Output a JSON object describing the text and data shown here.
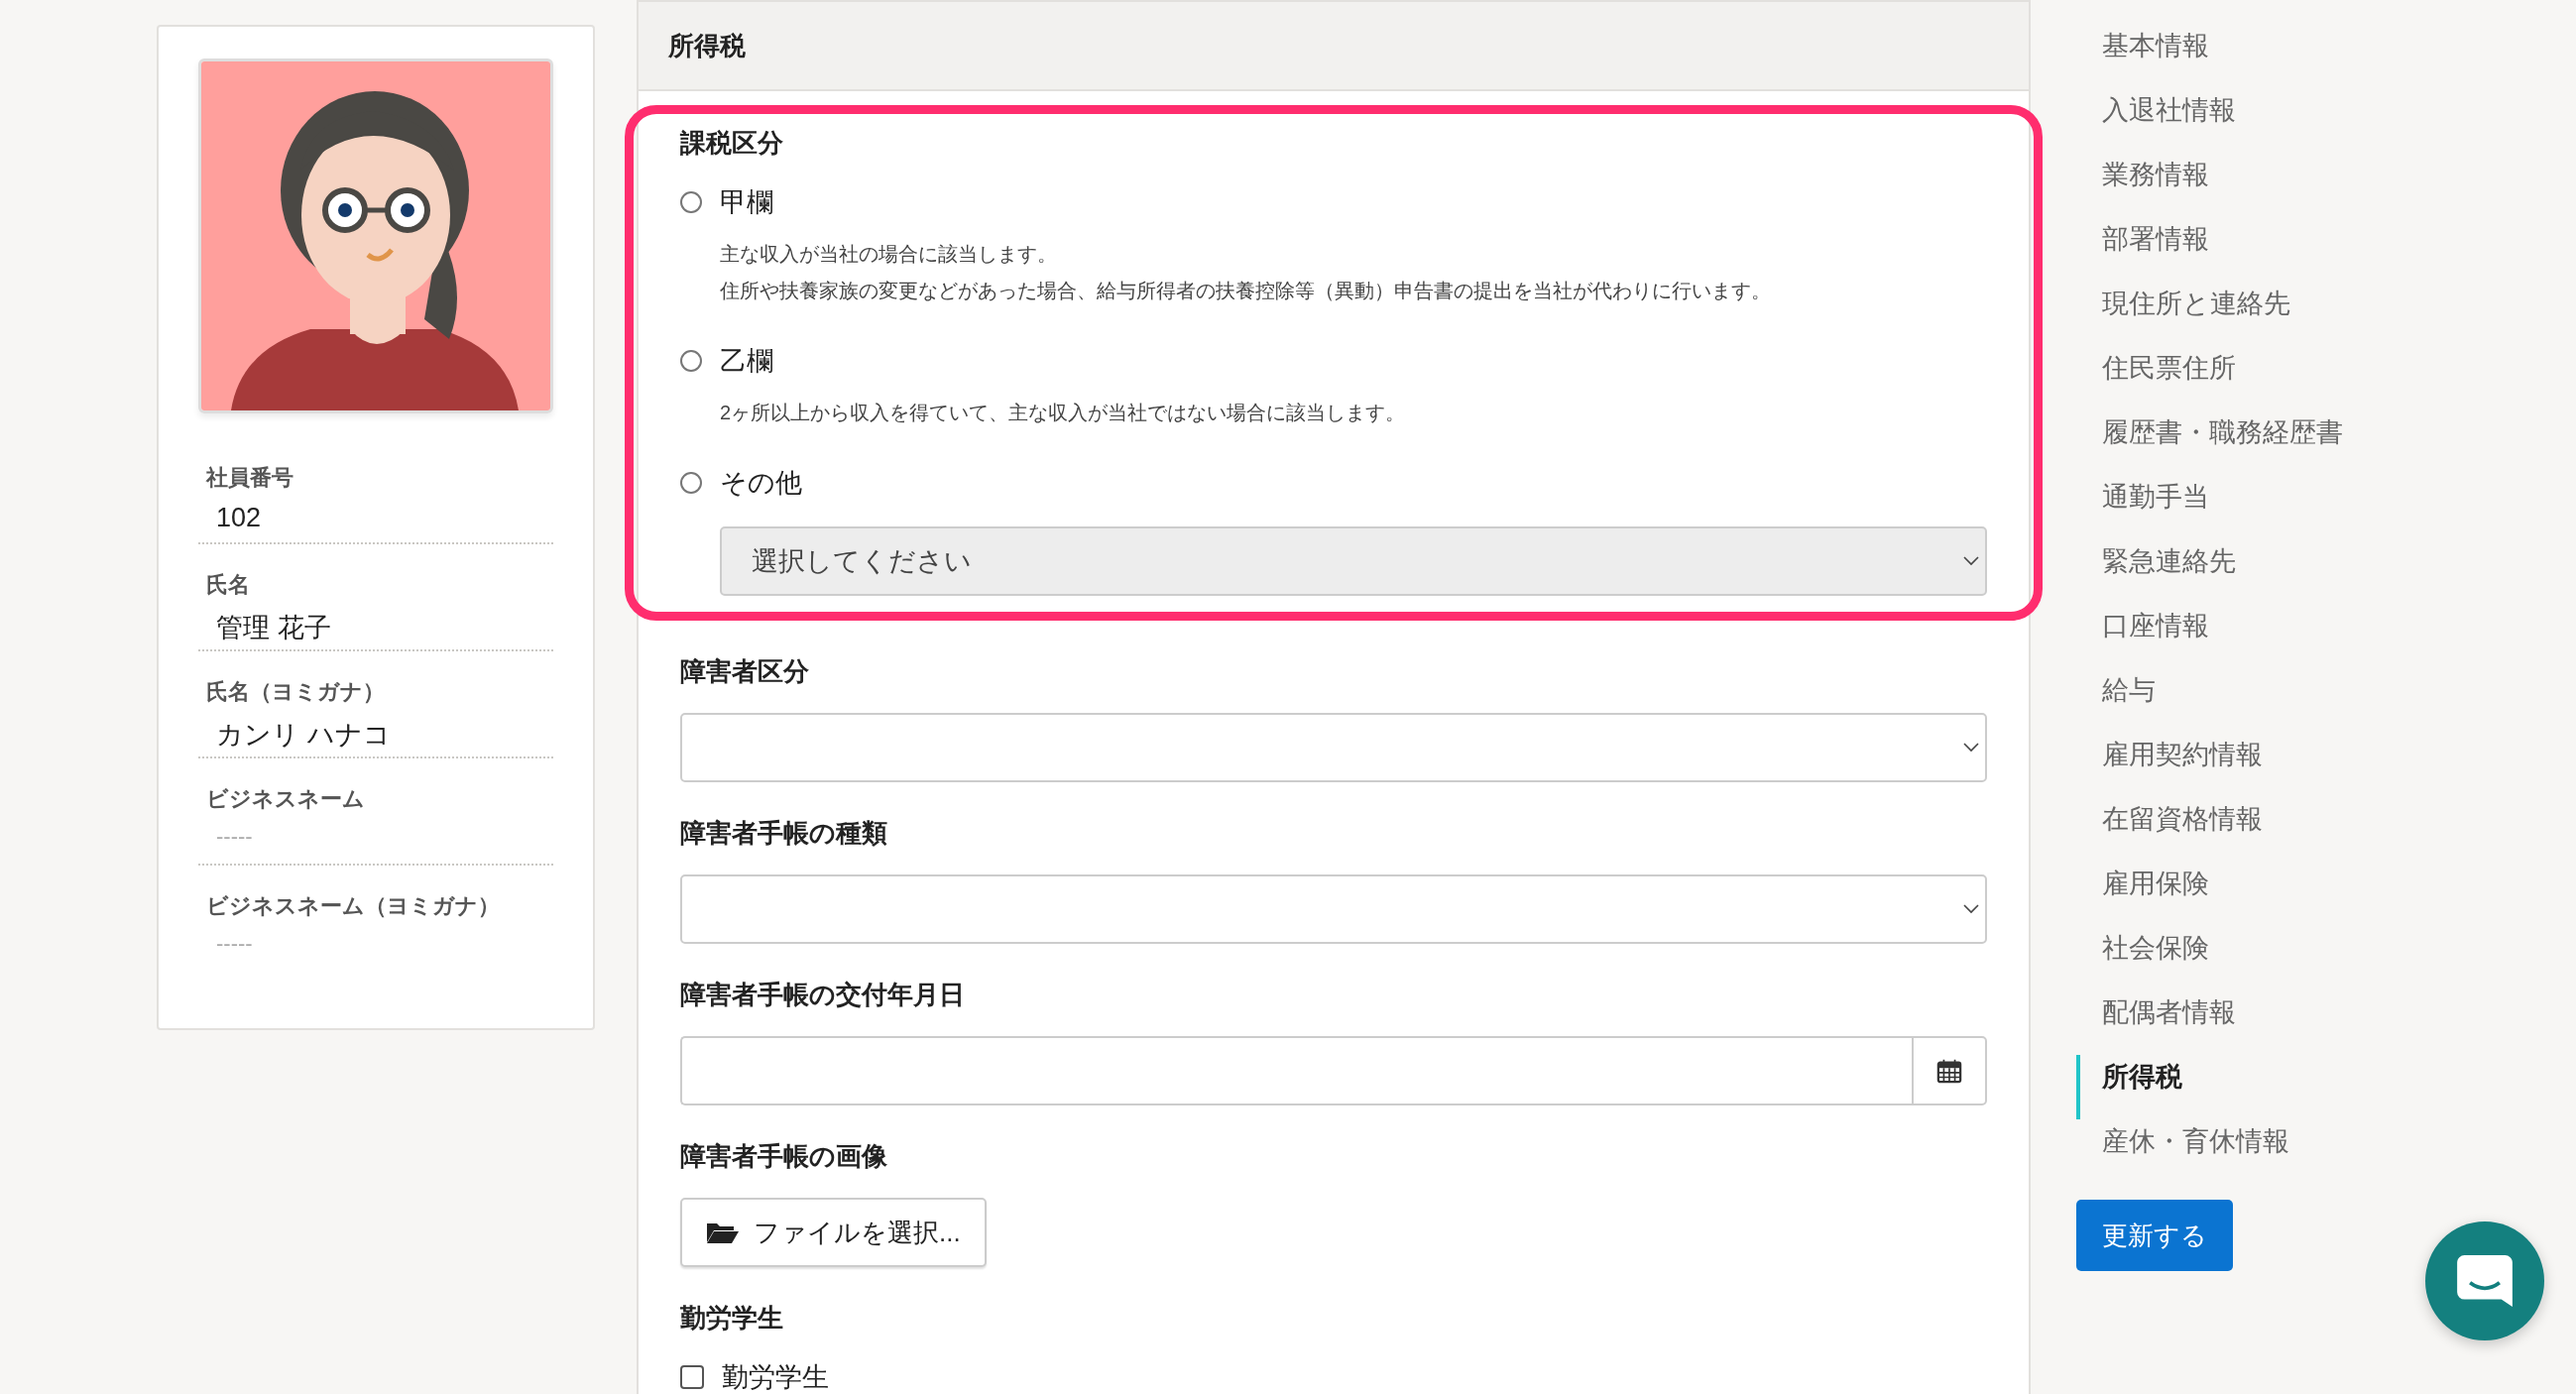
{
  "profile": {
    "fields": [
      {
        "label": "社員番号",
        "value": "102",
        "kind": "filled"
      },
      {
        "label": "氏名",
        "value": "管理 花子",
        "kind": "filled"
      },
      {
        "label": "氏名（ヨミガナ）",
        "value": "カンリ ハナコ",
        "kind": "filled"
      },
      {
        "label": "ビジネスネーム",
        "value": "-----",
        "kind": "empty"
      },
      {
        "label": "ビジネスネーム（ヨミガナ）",
        "value": "-----",
        "kind": "empty"
      }
    ]
  },
  "form": {
    "title": "所得税",
    "sections": [
      {
        "kind": "radio",
        "label": "課税区分",
        "highlighted": true,
        "options": [
          {
            "label": "甲欄",
            "selected": false,
            "description": [
              "主な収入が当社の場合に該当します。",
              "住所や扶養家族の変更などがあった場合、給与所得者の扶養控除等（異動）申告書の提出を当社が代わりに行います。"
            ]
          },
          {
            "label": "乙欄",
            "selected": false,
            "description": [
              "2ヶ所以上から収入を得ていて、主な収入が当社ではない場合に該当します。"
            ]
          },
          {
            "label": "その他",
            "selected": false,
            "select": {
              "placeholder": "選択してください",
              "disabled": true
            }
          }
        ]
      },
      {
        "kind": "select",
        "label": "障害者区分",
        "highlighted": false
      },
      {
        "kind": "select",
        "label": "障害者手帳の種類",
        "highlighted": false
      },
      {
        "kind": "date",
        "label": "障害者手帳の交付年月日",
        "highlighted": false
      },
      {
        "kind": "file",
        "label": "障害者手帳の画像",
        "highlighted": false,
        "button": "ファイルを選択..."
      },
      {
        "kind": "checkbox",
        "label": "勤労学生",
        "highlighted": false,
        "options": [
          {
            "label": "勤労学生",
            "checked": false
          }
        ]
      }
    ]
  },
  "nav": {
    "items": [
      {
        "label": "基本情報",
        "selected": false
      },
      {
        "label": "入退社情報",
        "selected": false
      },
      {
        "label": "業務情報",
        "selected": false
      },
      {
        "label": "部署情報",
        "selected": false
      },
      {
        "label": "現住所と連絡先",
        "selected": false
      },
      {
        "label": "住民票住所",
        "selected": false
      },
      {
        "label": "履歴書・職務経歴書",
        "selected": false
      },
      {
        "label": "通勤手当",
        "selected": false
      },
      {
        "label": "緊急連絡先",
        "selected": false
      },
      {
        "label": "口座情報",
        "selected": false
      },
      {
        "label": "給与",
        "selected": false
      },
      {
        "label": "雇用契約情報",
        "selected": false
      },
      {
        "label": "在留資格情報",
        "selected": false
      },
      {
        "label": "雇用保険",
        "selected": false
      },
      {
        "label": "社会保険",
        "selected": false
      },
      {
        "label": "配偶者情報",
        "selected": false
      },
      {
        "label": "所得税",
        "selected": true
      },
      {
        "label": "産休・育休情報",
        "selected": false
      }
    ],
    "update_button": "更新する"
  }
}
